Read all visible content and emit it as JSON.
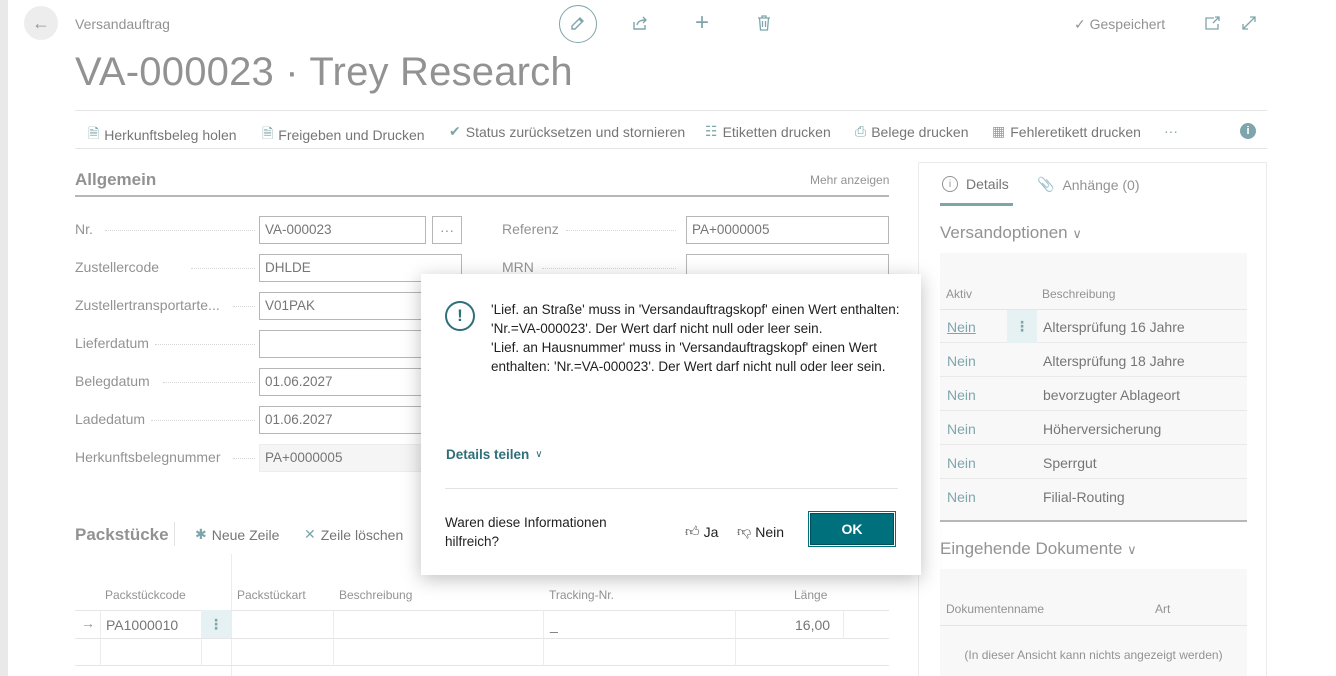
{
  "header": {
    "breadcrumb": "Versandauftrag",
    "title": "VA-000023 · Trey Research",
    "saved_status": "Gespeichert"
  },
  "actions": [
    "Herkunftsbeleg holen",
    "Freigeben und Drucken",
    "Status zurücksetzen und stornieren",
    "Etiketten drucken",
    "Belege drucken",
    "Fehleretikett drucken"
  ],
  "general": {
    "title": "Allgemein",
    "show_more": "Mehr anzeigen",
    "fields": {
      "nr_label": "Nr.",
      "nr_value": "VA-000023",
      "zustellercode_label": "Zustellercode",
      "zustellercode_value": "DHLDE",
      "transportart_label": "Zustellertransportarte...",
      "transportart_value": "V01PAK",
      "lieferdatum_label": "Lieferdatum",
      "lieferdatum_value": "",
      "belegdatum_label": "Belegdatum",
      "belegdatum_value": "01.06.2027",
      "ladedatum_label": "Ladedatum",
      "ladedatum_value": "01.06.2027",
      "herkunft_label": "Herkunftsbelegnummer",
      "herkunft_value": "PA+0000005",
      "referenz_label": "Referenz",
      "referenz_value": "PA+0000005",
      "mrn_label": "MRN",
      "mrn_value": ""
    }
  },
  "packages": {
    "title": "Packstücke",
    "new_line": "Neue Zeile",
    "delete_line": "Zeile löschen",
    "columns": [
      "Packstückcode",
      "Packstückart",
      "Beschreibung",
      "Tracking-Nr.",
      "Länge"
    ],
    "rows": [
      {
        "code": "PA1000010",
        "art": "",
        "beschreibung": "",
        "tracking": "_",
        "laenge": "16,00"
      }
    ]
  },
  "factbox": {
    "tab_details": "Details",
    "tab_attachments": "Anhänge (0)",
    "shipping_options_title": "Versandoptionen",
    "col_active": "Aktiv",
    "col_description": "Beschreibung",
    "options": [
      {
        "active": "Nein",
        "description": "Altersprüfung 16 Jahre"
      },
      {
        "active": "Nein",
        "description": "Altersprüfung 18 Jahre"
      },
      {
        "active": "Nein",
        "description": "bevorzugter Ablageort"
      },
      {
        "active": "Nein",
        "description": "Höherversicherung"
      },
      {
        "active": "Nein",
        "description": "Sperrgut"
      },
      {
        "active": "Nein",
        "description": "Filial-Routing"
      }
    ],
    "incoming_title": "Eingehende Dokumente",
    "col_docname": "Dokumentenname",
    "col_type": "Art",
    "empty_text": "(In dieser Ansicht kann nichts angezeigt werden)"
  },
  "dialog": {
    "message": "'Lief. an Straße' muss in 'Versandauftragskopf' einen Wert enthalten: 'Nr.=VA-000023'. Der Wert darf nicht null oder leer sein.\n'Lief. an Hausnummer' muss in 'Versandauftragskopf' einen Wert enthalten: 'Nr.=VA-000023'. Der Wert darf nicht null oder leer sein.",
    "share_details": "Details teilen",
    "feedback_question": "Waren diese Informationen hilfreich?",
    "yes": "Ja",
    "no": "Nein",
    "ok": "OK"
  }
}
